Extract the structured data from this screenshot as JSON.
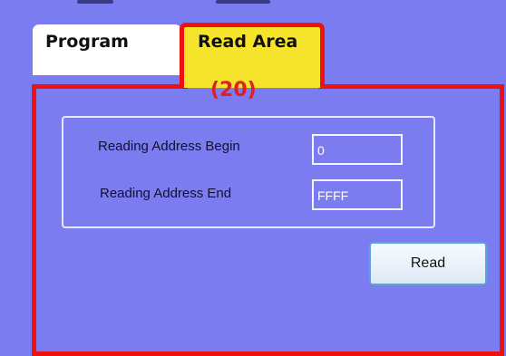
{
  "tabs": [
    {
      "label": "Program",
      "active": false
    },
    {
      "label": "Read Area",
      "active": true
    }
  ],
  "annotation": "(20)",
  "read_area": {
    "begin_label": "Reading Address Begin",
    "begin_value": "0",
    "end_label": "Reading Address End",
    "end_value": "FFFF",
    "read_button_label": "Read"
  },
  "colors": {
    "background": "#7b7cf0",
    "highlight": "#f01010",
    "active_tab": "#f6e32c"
  }
}
